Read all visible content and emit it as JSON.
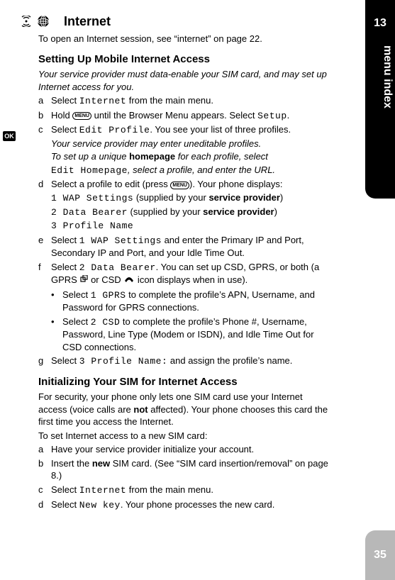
{
  "sideTab": {
    "chapter": "13",
    "label": "menu index",
    "pageNumber": "35"
  },
  "okBadge": "OK",
  "menuKey": "MENU",
  "header": {
    "signalIcon": "signal-icon",
    "globeIcon": "globe-icon",
    "title": "Internet"
  },
  "intro": "To open an Internet session, see “internet” on page 22.",
  "setup": {
    "heading": "Setting Up Mobile Internet Access",
    "note": "Your service provider must data-enable your SIM card, and may set up Internet access for you.",
    "stepA": {
      "label": "a",
      "pre": "Select ",
      "mono": "Internet",
      "post": " from the main menu."
    },
    "stepB": {
      "label": "b",
      "pre": "Hold ",
      "mid": " until the Browser Menu appears. Select ",
      "mono": "Setup",
      "post": "."
    },
    "stepC": {
      "label": "c",
      "pre": "Select ",
      "mono": "Edit Profile",
      "post": ". You see your list of three profiles."
    },
    "providerNote": {
      "line1": "Your service provider may enter uneditable profiles.",
      "line2pre": "To set up a unique ",
      "line2bold": "homepage",
      "line2mid": " for each profile, select ",
      "line3mono": "Edit Homepage",
      "line3post": ", select a profile, and enter the URL."
    },
    "stepD": {
      "label": "d",
      "line1pre": "Select a profile to edit (press ",
      "line1post": "). Your phone displays:",
      "opt1mono": "1 WAP Settings",
      "opt1pre": " (supplied by your ",
      "opt1bold": "service provider",
      "opt1post": ")",
      "opt2mono": "2 Data Bearer",
      "opt2pre": " (supplied by your ",
      "opt2bold": "service provider",
      "opt2post": ")",
      "opt3mono": "3 Profile Name"
    },
    "stepE": {
      "label": "e",
      "pre": "Select ",
      "mono": "1 WAP Settings",
      "post": " and enter the Primary IP and Port, Secondary IP and Port, and your Idle Time Out."
    },
    "stepF": {
      "label": "f",
      "pre": "Select ",
      "mono": "2 Data Bearer",
      "post1": ". You can set up CSD, GPRS, or both (a GPRS ",
      "post2": " or CSD ",
      "post3": " icon displays when in use)."
    },
    "bullet1": {
      "pre": "Select ",
      "mono": "1 GPRS",
      "post": " to complete the profile’s APN, Username, and Password for GPRS connections."
    },
    "bullet2": {
      "pre": "Select ",
      "mono": "2 CSD",
      "post": " to complete the profile’s Phone #, Username, Password, Line Type (Modem or ISDN), and Idle Time Out for CSD connections."
    },
    "stepG": {
      "label": "g",
      "pre": "Select ",
      "mono": "3 Profile Name:",
      "post": " and assign the profile’s name."
    }
  },
  "init": {
    "heading": "Initializing Your SIM for Internet Access",
    "p1pre": "For security, your phone only lets one SIM card use your Internet access (voice calls are ",
    "p1bold": "not",
    "p1post": " affected). Your phone chooses this card the first time you access the Internet.",
    "p2": "To set Internet access to a new SIM card:",
    "stepA": {
      "label": "a",
      "text": "Have your service provider initialize your account."
    },
    "stepB": {
      "label": "b",
      "pre": "Insert the ",
      "bold": "new",
      "post": " SIM card. (See “SIM card insertion/removal” on page 8.)"
    },
    "stepC": {
      "label": "c",
      "pre": "Select ",
      "mono": "Internet",
      "post": " from the main menu."
    },
    "stepD": {
      "label": "d",
      "pre": "Select ",
      "mono": "New key",
      "post": ". Your phone processes the new card."
    }
  }
}
